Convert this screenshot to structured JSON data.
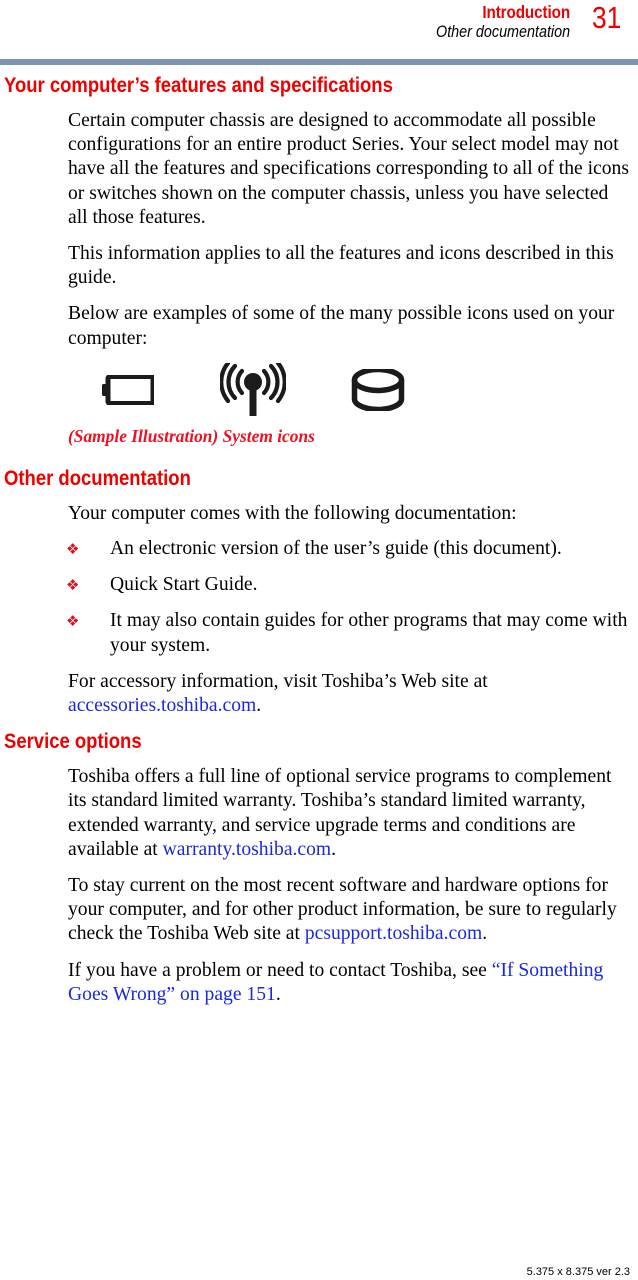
{
  "header": {
    "chapter": "Introduction",
    "section": "Other documentation",
    "page_number": "31",
    "rule_color": "#7c94ad"
  },
  "colors": {
    "heading_red": "#ee0000",
    "caption_red": "#ee1122",
    "bullet_red": "#dd1122",
    "link_blue": "#1a27e0",
    "body_black": "#000000"
  },
  "sections": {
    "features": {
      "heading": "Your computer’s features and specifications",
      "paragraphs": [
        "Certain computer chassis are designed to accommodate all possible configurations for an entire product Series. Your select model may not have all the features and specifications corresponding to all of the icons or switches shown on the computer chassis, unless you have selected all those features.",
        "This information applies to all the features and icons described in this guide.",
        "Below are examples of some of the many possible icons used on your computer:"
      ],
      "icons": [
        {
          "name": "battery-icon",
          "label": "Battery"
        },
        {
          "name": "wireless-antenna-icon",
          "label": "Wireless"
        },
        {
          "name": "disk-drive-icon",
          "label": "Disk drive"
        }
      ],
      "caption": "(Sample Illustration) System icons"
    },
    "other_documentation": {
      "heading": "Other documentation",
      "intro": "Your computer comes with the following documentation:",
      "bullet_glyph": "❖",
      "items": [
        "An electronic version of the user’s guide (this document).",
        "Quick Start Guide.",
        "It may also contain guides for other programs that may come with your system."
      ],
      "accessory_lead": "For accessory information, visit Toshiba’s Web site at ",
      "accessory_link": "accessories.toshiba.com",
      "accessory_tail": "."
    },
    "service_options": {
      "heading": "Service options",
      "para1_lead": "Toshiba offers a full line of optional service programs to complement its standard limited warranty. Toshiba’s standard limited warranty, extended warranty, and service upgrade terms and conditions are available at ",
      "para1_link": "warranty.toshiba.com",
      "para1_tail": ".",
      "para2_lead": "To stay current on the most recent software and hardware options for your computer, and for other product information, be sure to regularly check the Toshiba Web site at ",
      "para2_link": "pcsupport.toshiba.com",
      "para2_tail": ".",
      "para3_lead": "If you have a problem or need to contact Toshiba, see ",
      "para3_link": "“If Something Goes Wrong” on page 151",
      "para3_tail": "."
    }
  },
  "footer": {
    "spec": "5.375 x 8.375 ver 2.3"
  }
}
